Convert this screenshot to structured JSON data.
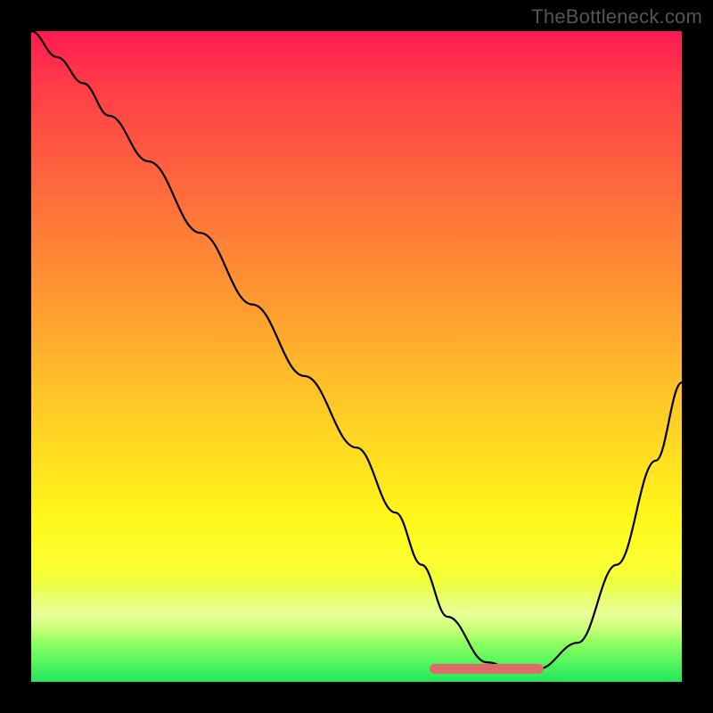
{
  "watermark": "TheBottleneck.com",
  "chart_data": {
    "type": "line",
    "title": "",
    "xlabel": "",
    "ylabel": "",
    "xlim": [
      0,
      100
    ],
    "ylim": [
      0,
      100
    ],
    "series": [
      {
        "name": "bottleneck-curve",
        "x": [
          0,
          4,
          8,
          12,
          18,
          26,
          34,
          42,
          50,
          56,
          60,
          64,
          70,
          74,
          78,
          84,
          90,
          96,
          100
        ],
        "y": [
          100,
          96,
          92,
          87,
          80,
          69,
          58,
          47,
          36,
          26,
          18,
          10,
          3,
          2,
          2,
          6,
          18,
          34,
          46
        ]
      },
      {
        "name": "optimal-flat-region",
        "x": [
          62,
          78
        ],
        "y": [
          2,
          2
        ]
      }
    ],
    "colors": {
      "curve": "#000000",
      "flat_region": "#e06a6a",
      "gradient_top": "#ff1a52",
      "gradient_bottom": "#22e85a"
    },
    "annotations": []
  }
}
